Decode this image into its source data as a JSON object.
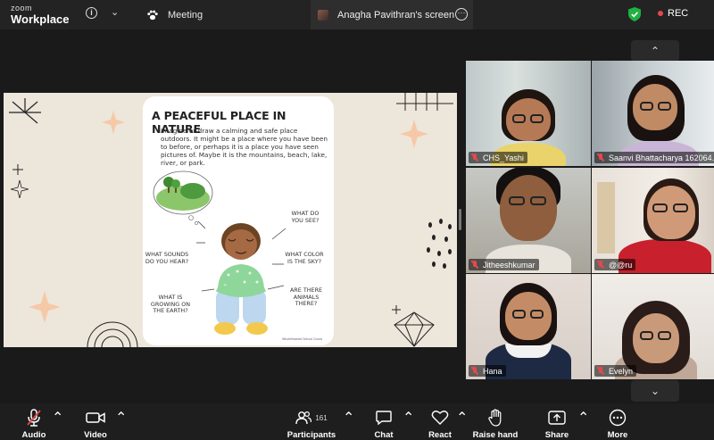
{
  "app": {
    "logo_top": "zoom",
    "logo_bottom": "Workplace"
  },
  "tabs": {
    "meeting": "Meeting",
    "screen": "Anagha Pavithran's screen"
  },
  "status": {
    "rec_label": "REC",
    "rec_color": "#e5484d",
    "shield_color": "#1fb141"
  },
  "slide": {
    "title": "A PEACEFUL PLACE IN NATURE",
    "paragraph": "Imagine or draw a calming and safe place outdoors. It might be a place where you have been to before, or perhaps it is a place you have seen pictures of. Maybe it is the mountains, beach, lake, river, or park.",
    "q_see": "WHAT DO YOU SEE?",
    "q_hear": "WHAT SOUNDS DO YOU HEAR?",
    "q_color": "WHAT COLOR IS THE SKY?",
    "q_growing": "WHAT IS GROWING ON THE EARTH?",
    "q_animals": "ARE THERE ANIMALS THERE?",
    "credit": "WholeHearted School Couns"
  },
  "participants_gallery": [
    {
      "name": "CHS_Yashi",
      "muted": true
    },
    {
      "name": "Saanvi Bhattacharya 162064...",
      "muted": true
    },
    {
      "name": "Jitheeshkumar",
      "muted": true
    },
    {
      "name": "@@ru",
      "muted": true
    },
    {
      "name": "Hana",
      "muted": true
    },
    {
      "name": "Evelyn",
      "muted": true
    }
  ],
  "toolbar": {
    "audio": "Audio",
    "video": "Video",
    "participants": "Participants",
    "participants_count": "161",
    "chat": "Chat",
    "react": "React",
    "raise_hand": "Raise hand",
    "share": "Share",
    "more": "More"
  }
}
